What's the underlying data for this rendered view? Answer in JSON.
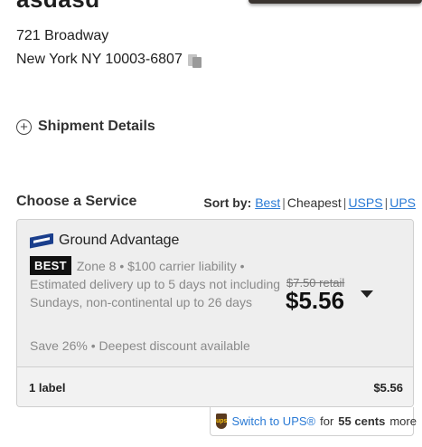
{
  "recipient": {
    "name": "asdasd",
    "address_line1": "721 Broadway",
    "address_line2": "New York NY 10003-6807"
  },
  "shipment_details_label": "Shipment Details",
  "services": {
    "heading": "Choose a Service",
    "sort_label": "Sort by:",
    "sort_options": [
      "Best",
      "Cheapest",
      "USPS",
      "UPS"
    ],
    "sort_selected": "Cheapest",
    "sep": "|"
  },
  "card": {
    "service_name": "Ground Advantage",
    "badge": "BEST",
    "meta": "Zone 8 • $100 carrier liability •",
    "estimate": "Estimated delivery up to 5 days not including Sundays, non-continental up to 26 days",
    "savings": "Save 26% • Deepest discount available",
    "retail_price": "$7.50 retail",
    "price": "$5.56",
    "labels_count": "1 label",
    "total": "$5.56"
  },
  "ups_promo": {
    "link_text": "Switch to UPS®",
    "for_text": "for",
    "amount": "55 cents",
    "suffix": "more"
  },
  "icons": [
    "copy-icon",
    "plus-circle-icon",
    "usps-eagle-icon",
    "caret-down-icon",
    "ups-shield-icon"
  ],
  "colors": {
    "link": "#2a7ad5",
    "badge_bg": "#111111",
    "usps_blue": "#1a3e8c",
    "ups_brown": "#5a3a1e",
    "ups_gold": "#f6c20f"
  }
}
